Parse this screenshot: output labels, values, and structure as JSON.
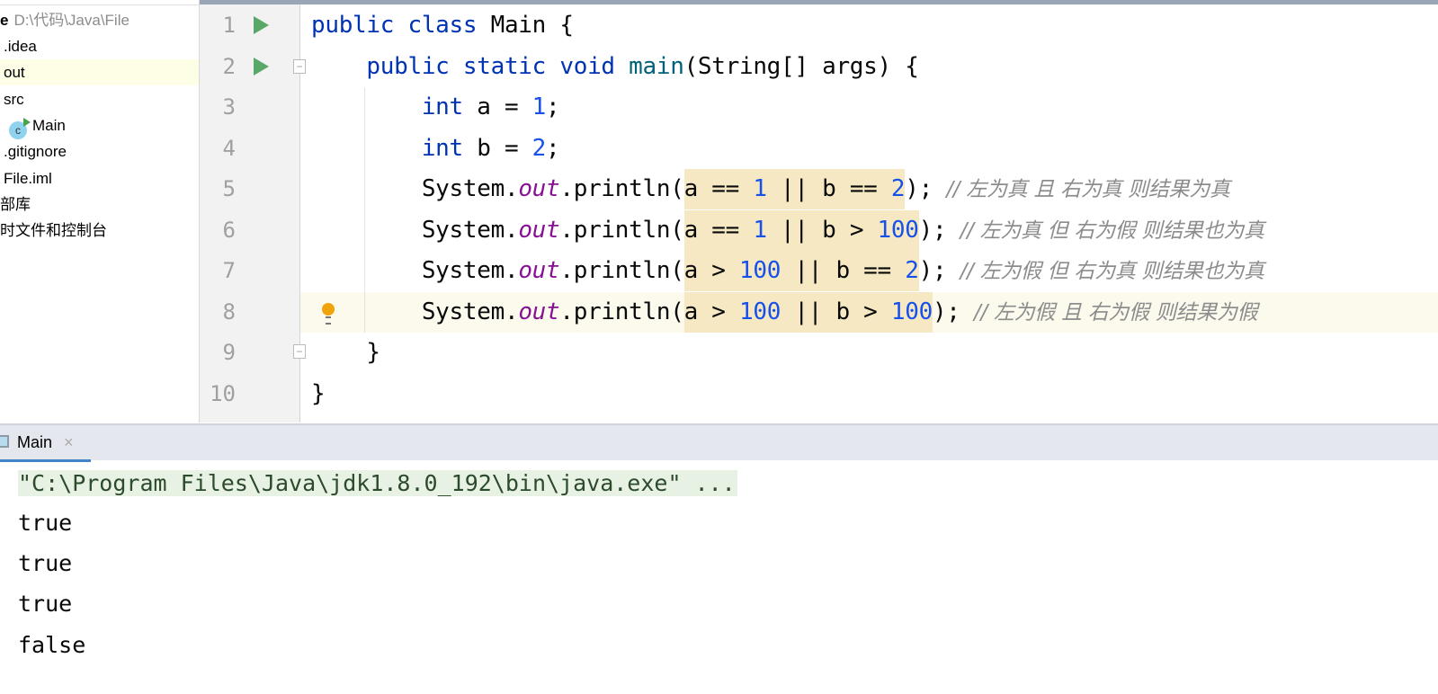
{
  "project": {
    "root_suffix": "e",
    "root_path": "D:\\代码\\Java\\File",
    "items": [
      {
        "label": ".idea"
      },
      {
        "label": "out",
        "selected": true
      },
      {
        "label": "src"
      },
      {
        "label": "Main",
        "icon": "java-class-icon"
      },
      {
        "label": ".gitignore"
      },
      {
        "label": "File.iml"
      },
      {
        "label": "部库"
      },
      {
        "label": "时文件和控制台"
      }
    ]
  },
  "editor": {
    "line_numbers": [
      "1",
      "2",
      "3",
      "4",
      "5",
      "6",
      "7",
      "8",
      "9",
      "10"
    ],
    "current_line": 8,
    "lines": [
      [
        {
          "t": "public class ",
          "c": "kw"
        },
        {
          "t": "Main {"
        }
      ],
      [
        {
          "t": "    public static void ",
          "c": "kw"
        },
        {
          "t": "main",
          "c": "method"
        },
        {
          "t": "(String[] args) {"
        }
      ],
      [
        {
          "t": "        int ",
          "c": "kw"
        },
        {
          "t": "a = "
        },
        {
          "t": "1",
          "c": "num"
        },
        {
          "t": ";"
        }
      ],
      [
        {
          "t": "        int ",
          "c": "kw"
        },
        {
          "t": "b = "
        },
        {
          "t": "2",
          "c": "num"
        },
        {
          "t": ";"
        }
      ],
      [
        {
          "t": "        System."
        },
        {
          "t": "out",
          "c": "field"
        },
        {
          "t": ".println("
        },
        {
          "hl": [
            {
              "t": "a == "
            },
            {
              "t": "1",
              "c": "num"
            },
            {
              "t": " || b == "
            },
            {
              "t": "2",
              "c": "num"
            }
          ]
        },
        {
          "t": "); "
        },
        {
          "t": "// 左为真 且 右为真 则结果为真",
          "c": "comment"
        }
      ],
      [
        {
          "t": "        System."
        },
        {
          "t": "out",
          "c": "field"
        },
        {
          "t": ".println("
        },
        {
          "hl": [
            {
              "t": "a == "
            },
            {
              "t": "1",
              "c": "num"
            },
            {
              "t": " || b > "
            },
            {
              "t": "100",
              "c": "num"
            }
          ]
        },
        {
          "t": "); "
        },
        {
          "t": "// 左为真 但 右为假 则结果也为真",
          "c": "comment"
        }
      ],
      [
        {
          "t": "        System."
        },
        {
          "t": "out",
          "c": "field"
        },
        {
          "t": ".println("
        },
        {
          "hl": [
            {
              "t": "a > "
            },
            {
              "t": "100",
              "c": "num"
            },
            {
              "t": " || b == "
            },
            {
              "t": "2",
              "c": "num"
            }
          ]
        },
        {
          "t": "); "
        },
        {
          "t": "// 左为假 但 右为真 则结果也为真",
          "c": "comment"
        }
      ],
      [
        {
          "t": "        System."
        },
        {
          "t": "out",
          "c": "field"
        },
        {
          "t": ".println("
        },
        {
          "hl": [
            {
              "t": "a > "
            },
            {
              "t": "100",
              "c": "num"
            },
            {
              "t": " || b > "
            },
            {
              "t": "100",
              "c": "num"
            }
          ]
        },
        {
          "t": "); "
        },
        {
          "t": "// 左为假 且 右为假 则结果为假",
          "c": "comment"
        }
      ],
      [
        {
          "t": "    }"
        }
      ],
      [
        {
          "t": "}"
        }
      ]
    ]
  },
  "console": {
    "tab_label": "Main",
    "close_symbol": "×",
    "command": "\"C:\\Program Files\\Java\\jdk1.8.0_192\\bin\\java.exe\" ...",
    "output": [
      "true",
      "true",
      "true",
      "false"
    ]
  },
  "colors": {
    "keyword": "#0033b3",
    "number": "#1750eb",
    "field": "#871094",
    "comment": "#8c8c8c",
    "highlight": "#f5e8c2",
    "run": "#59a869"
  }
}
